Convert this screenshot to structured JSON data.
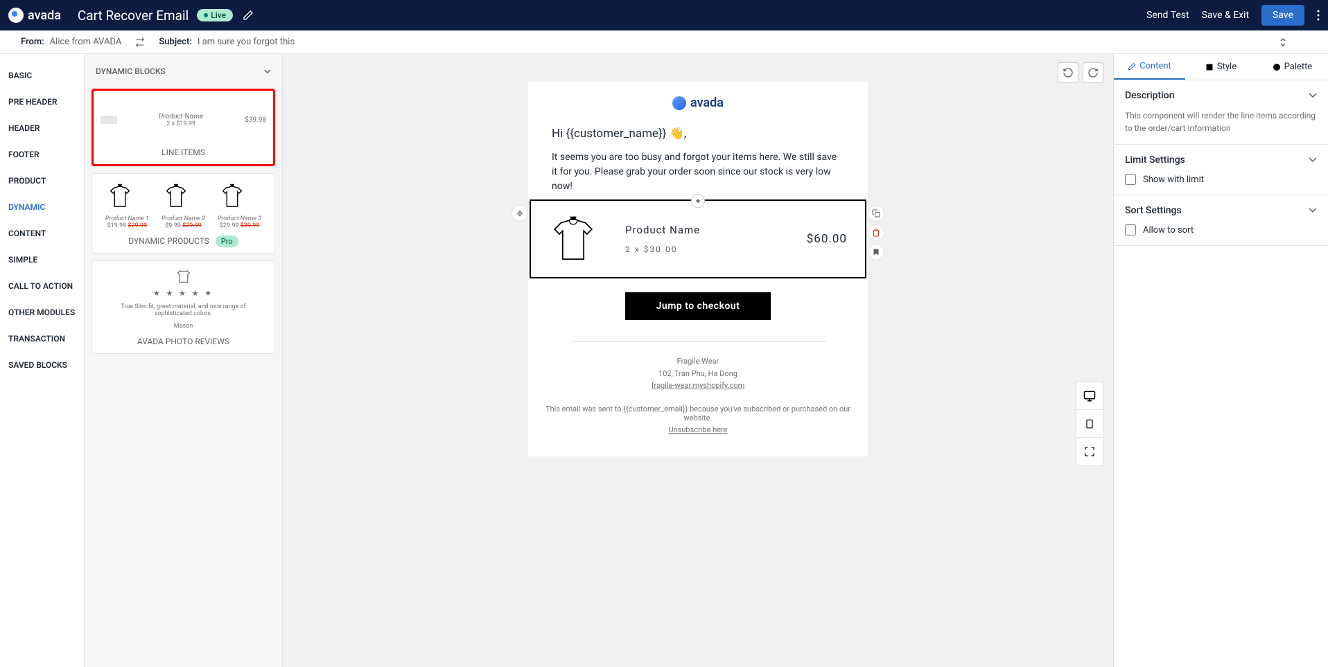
{
  "header": {
    "brand": "avada",
    "title": "Cart Recover Email",
    "live_badge": "Live",
    "send_test": "Send Test",
    "save_exit": "Save & Exit",
    "save": "Save"
  },
  "subbar": {
    "from_label": "From:",
    "from_value": "Alice from AVADA",
    "subject_label": "Subject:",
    "subject_value": "I am sure you forgot this"
  },
  "left_nav": [
    "BASIC",
    "PRE HEADER",
    "HEADER",
    "FOOTER",
    "PRODUCT",
    "DYNAMIC",
    "CONTENT",
    "SIMPLE",
    "CALL TO ACTION",
    "OTHER MODULES",
    "TRANSACTION",
    "SAVED BLOCKS"
  ],
  "left_nav_active": 5,
  "blocks": {
    "header": "DYNAMIC BLOCKS",
    "line_items": {
      "label": "LINE ITEMS",
      "prod_name": "Product Name",
      "qty": "2 x $19.99",
      "price": "$39.98"
    },
    "dynamic_products": {
      "label": "DYNAMIC PRODUCTS",
      "badge": "Pro",
      "items": [
        {
          "name": "Product Name 1",
          "price": "$19.99",
          "old": "$29.99"
        },
        {
          "name": "Product Name 2",
          "price": "$9.99",
          "old": "$29.99"
        },
        {
          "name": "Product Name 3",
          "price": "$29.99",
          "old": "$39.99"
        }
      ]
    },
    "photo_reviews": {
      "label": "AVADA PHOTO REVIEWS",
      "text": "True Slim fit, great material, and nice range of sophisticated colors.",
      "author": "Mason"
    }
  },
  "email": {
    "logo_text": "avada",
    "greeting": "Hi {{customer_name}} 👋,",
    "body": "It seems you are too busy and forgot your items here. We still save it for you. Please grab your order soon since our stock is very low now!",
    "product": {
      "name": "Product Name",
      "qty": "2 x $30.00",
      "price": "$60.00"
    },
    "cta": "Jump to checkout",
    "footer_name": "Fragile Wear",
    "footer_addr": "102, Tran Phu, Ha Dong",
    "footer_url": "fragile-wear.myshopify.com",
    "disclaimer": "This email was sent to {{customer_email}} because you've subscribed or purchased on our website.",
    "unsubscribe": "Unsubscribe here"
  },
  "right": {
    "tabs": {
      "content": "Content",
      "style": "Style",
      "palette": "Palette"
    },
    "description": {
      "title": "Description",
      "text": "This component will render the line items according to the order/cart information"
    },
    "limit": {
      "title": "Limit Settings",
      "checkbox": "Show with limit"
    },
    "sort": {
      "title": "Sort Settings",
      "checkbox": "Allow to sort"
    }
  }
}
